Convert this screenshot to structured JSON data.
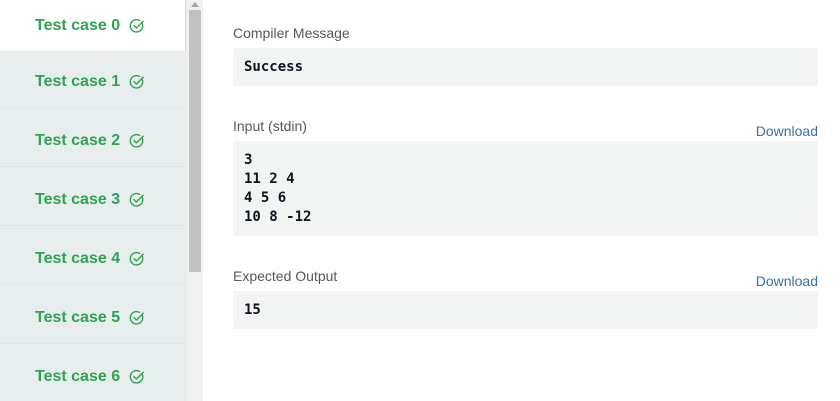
{
  "sidebar": {
    "test_cases": [
      {
        "label": "Test case 0",
        "status": "passed"
      },
      {
        "label": "Test case 1",
        "status": "passed"
      },
      {
        "label": "Test case 2",
        "status": "passed"
      },
      {
        "label": "Test case 3",
        "status": "passed"
      },
      {
        "label": "Test case 4",
        "status": "passed"
      },
      {
        "label": "Test case 5",
        "status": "passed"
      },
      {
        "label": "Test case 6",
        "status": "passed"
      }
    ],
    "selected_index": 0,
    "check_icon": "check-circle-icon",
    "colors": {
      "pass_green": "#2ea351",
      "sidebar_bg": "#e8eeee"
    }
  },
  "main": {
    "compiler": {
      "label": "Compiler Message",
      "value": "Success"
    },
    "input": {
      "label": "Input (stdin)",
      "download_label": "Download",
      "value": "3\n11 2 4\n4 5 6\n10 8 -12"
    },
    "expected": {
      "label": "Expected Output",
      "download_label": "Download",
      "value": "15"
    },
    "colors": {
      "link": "#39729f",
      "box_bg": "#f3f5f5"
    }
  }
}
